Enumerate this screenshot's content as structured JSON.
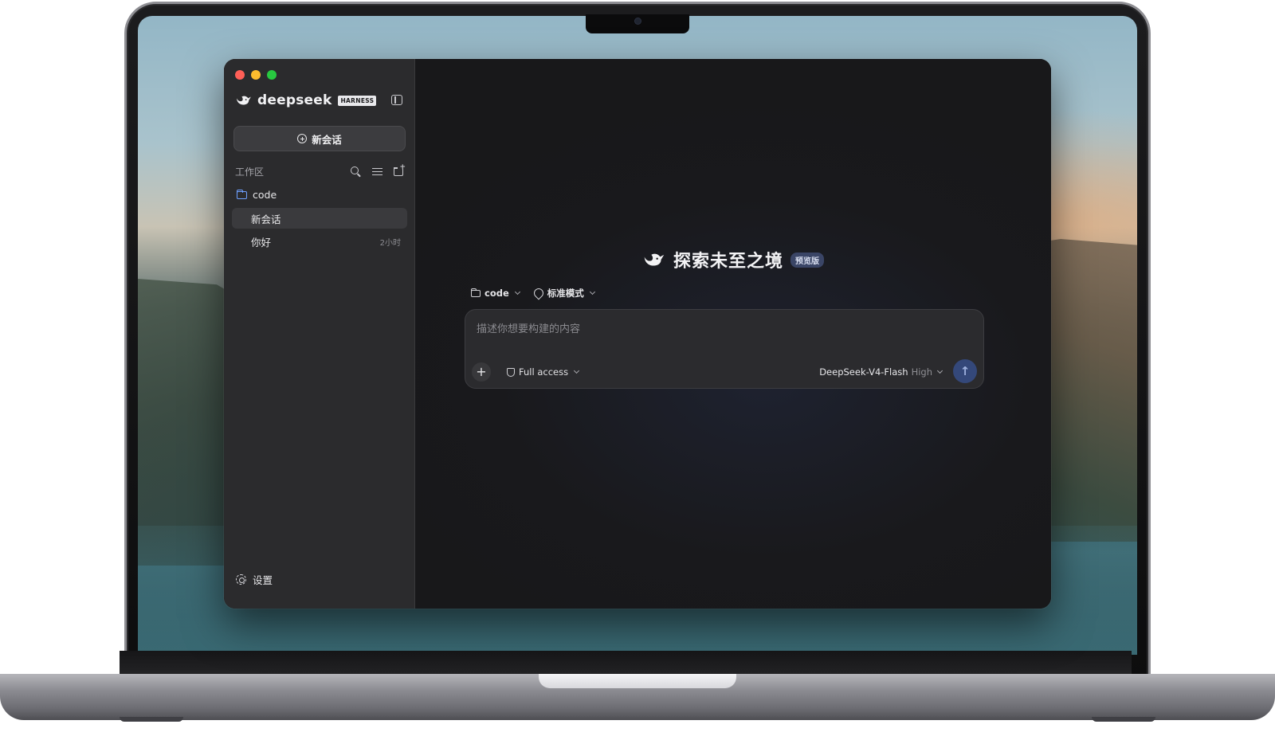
{
  "sidebar": {
    "brand_name": "deepseek",
    "brand_badge": "HARNESS",
    "new_chat_label": "新会话",
    "workspace_label": "工作区",
    "folder": "code",
    "chats": [
      {
        "title": "新会话",
        "time": "",
        "active": true
      },
      {
        "title": "你好",
        "time": "2小时",
        "active": false
      }
    ],
    "settings_label": "设置"
  },
  "main": {
    "hero_title": "探索未至之境",
    "hero_badge": "预览版",
    "folder_chip": "code",
    "mode_chip": "标准模式",
    "composer_placeholder": "描述你想要构建的内容",
    "access_label": "Full access",
    "model_name": "DeepSeek-V4-Flash",
    "model_level": "High"
  },
  "icons": {
    "window_controls": [
      "close-dot",
      "minimize-dot",
      "zoom-dot"
    ],
    "sidebar_tools": [
      "search-icon",
      "filter-icon",
      "new-folder-icon"
    ]
  },
  "colors": {
    "accent": "#6ea0ff",
    "send_button": "#34487a",
    "badge": "#3a4566"
  }
}
